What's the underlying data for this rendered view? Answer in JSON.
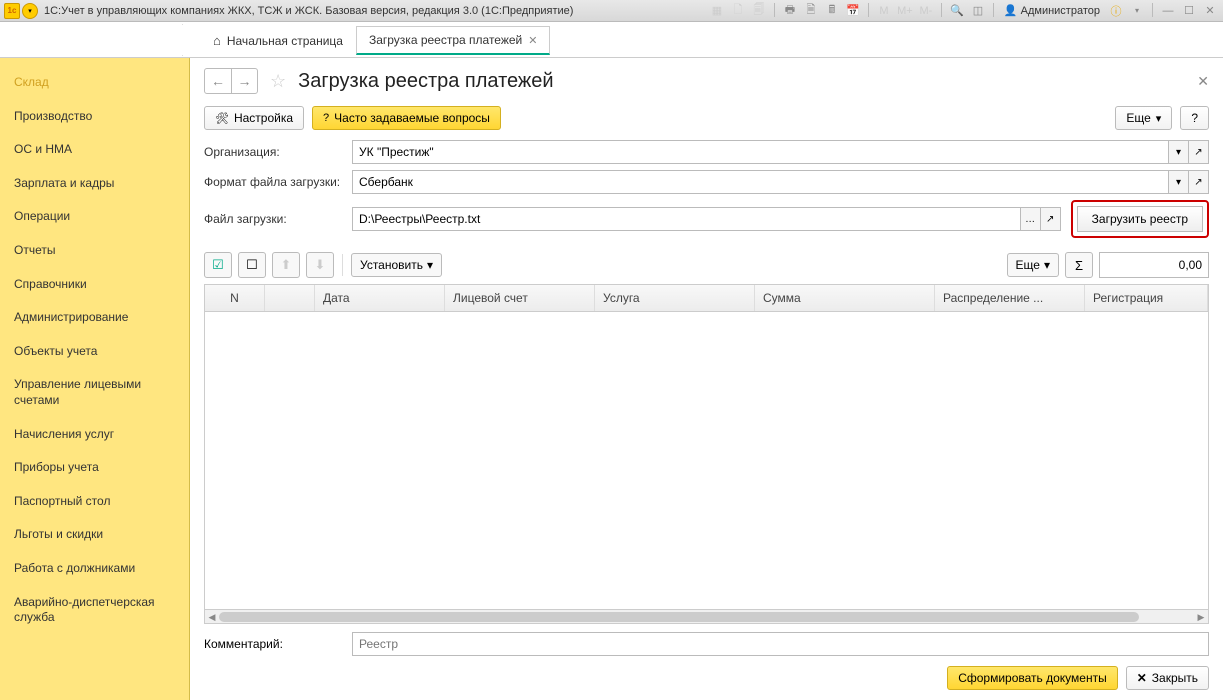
{
  "titlebar": {
    "title": "1С:Учет в управляющих компаниях ЖКХ, ТСЖ и ЖСК. Базовая версия, редакция 3.0  (1С:Предприятие)",
    "user": "Администратор",
    "m_labels": [
      "M",
      "M+",
      "M-"
    ]
  },
  "tabs": {
    "home": "Начальная страница",
    "active": "Загрузка реестра платежей"
  },
  "sidebar": {
    "items": [
      "Склад",
      "Производство",
      "ОС и НМА",
      "Зарплата и кадры",
      "Операции",
      "Отчеты",
      "Справочники",
      "Администрирование",
      "Объекты учета",
      "Управление лицевыми счетами",
      "Начисления услуг",
      "Приборы учета",
      "Паспортный стол",
      "Льготы и скидки",
      "Работа с должниками",
      "Аварийно-диспетчерская служба"
    ]
  },
  "header": {
    "title": "Загрузка реестра платежей"
  },
  "actions": {
    "settings": "Настройка",
    "faq": "Часто задаваемые вопросы",
    "more": "Еще",
    "help": "?"
  },
  "form": {
    "org_label": "Организация:",
    "org_value": "УК \"Престиж\"",
    "format_label": "Формат файла загрузки:",
    "format_value": "Сбербанк",
    "file_label": "Файл загрузки:",
    "file_value": "D:\\Реестры\\Реестр.txt",
    "load_button": "Загрузить реестр"
  },
  "table_toolbar": {
    "set": "Установить",
    "more": "Еще",
    "sigma": "Σ",
    "sum": "0,00"
  },
  "table": {
    "columns": [
      "N",
      "Дата",
      "Лицевой счет",
      "Услуга",
      "Сумма",
      "Распределение ...",
      "Регистрация "
    ]
  },
  "comment": {
    "label": "Комментарий:",
    "placeholder": "Реестр"
  },
  "footer": {
    "generate": "Сформировать документы",
    "close": "Закрыть"
  }
}
